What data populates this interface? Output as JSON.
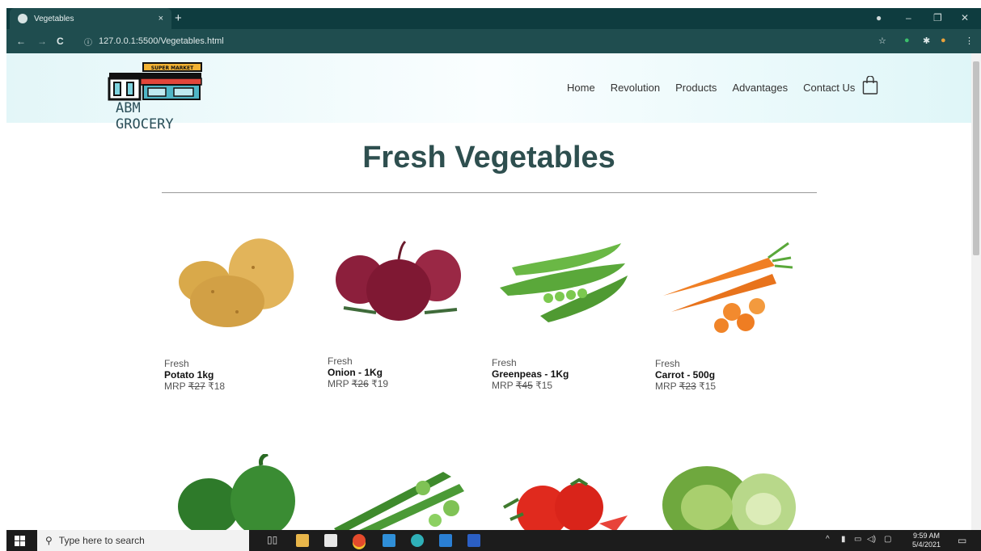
{
  "browser": {
    "tab_title": "Vegetables",
    "tab_close": "×",
    "new_tab": "+",
    "url": "127.0.0.1:5500/Vegetables.html",
    "back": "←",
    "forward": "→",
    "reload": "C",
    "window_min": "–",
    "window_max": "❐",
    "window_close": "✕"
  },
  "header": {
    "logo_sign": "SUPER MARKET",
    "logo_text": "ABM GROCERY",
    "nav": [
      "Home",
      "Revolution",
      "Products",
      "Advantages",
      "Contact Us"
    ]
  },
  "main": {
    "title": "Fresh Vegetables",
    "products": [
      {
        "fresh": "Fresh",
        "name": "Potato 1kg",
        "mrp_label": "MRP",
        "mrp": "₹27",
        "price": "₹18"
      },
      {
        "fresh": "Fresh",
        "name": "Onion - 1Kg",
        "mrp_label": "MRP",
        "mrp": "₹26",
        "price": "₹19"
      },
      {
        "fresh": "Fresh",
        "name": "Greenpeas - 1Kg",
        "mrp_label": "MRP",
        "mrp": "₹45",
        "price": "₹15"
      },
      {
        "fresh": "Fresh",
        "name": "Carrot - 500g",
        "mrp_label": "MRP",
        "mrp": "₹23",
        "price": "₹15"
      }
    ]
  },
  "taskbar": {
    "search_placeholder": "Type here to search",
    "time": "9:59 AM",
    "date": "5/4/2021"
  },
  "colors": {
    "browser_dark": "#0e3c3f",
    "browser_bar": "#1f4d4f",
    "title": "#2e4f4f",
    "header_bg": "#e3f6f8"
  }
}
